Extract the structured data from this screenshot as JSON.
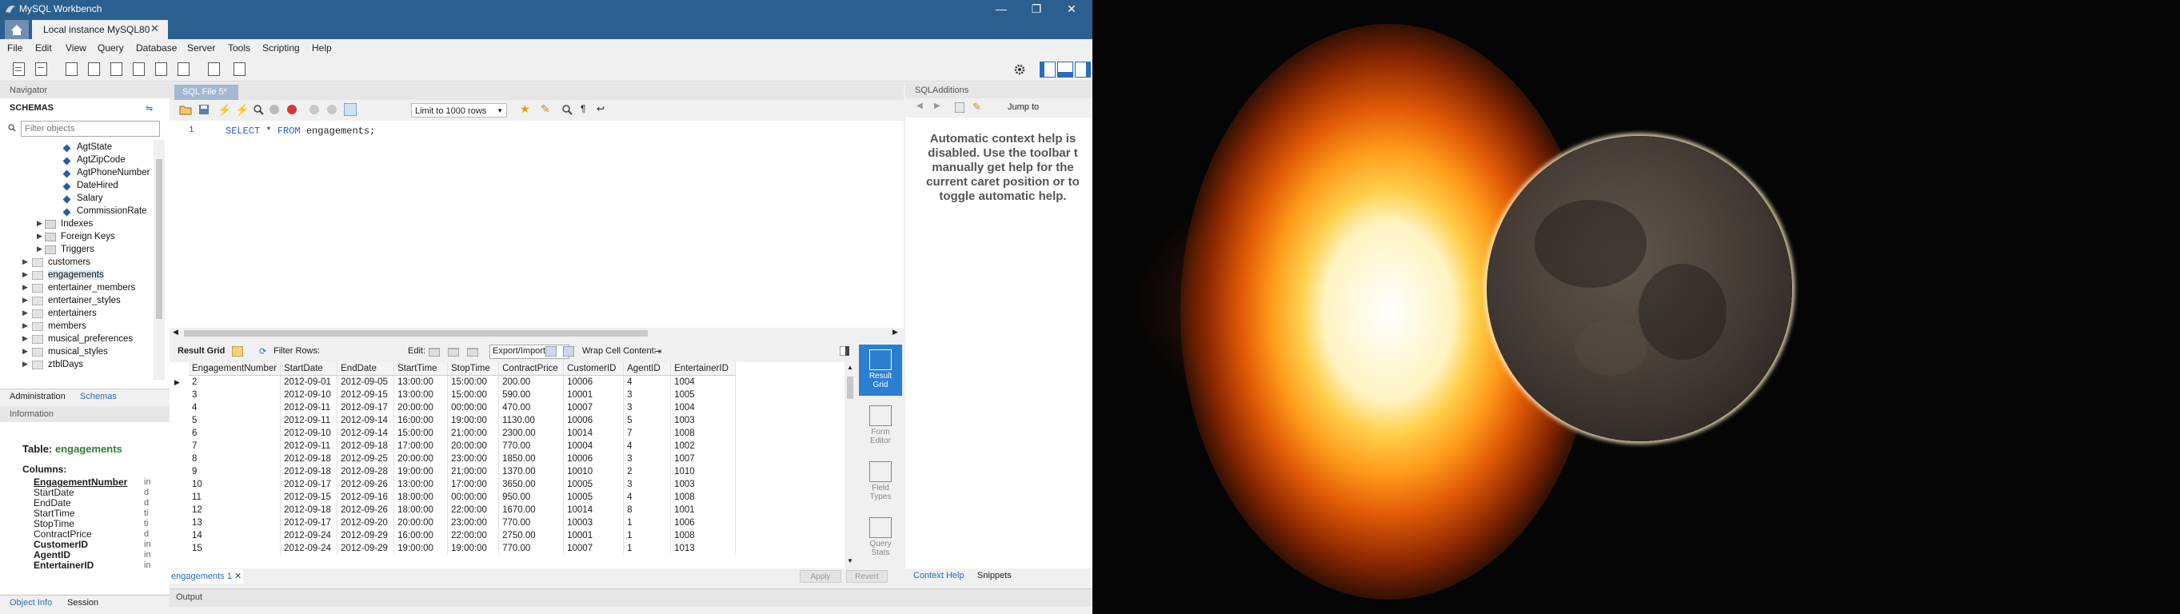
{
  "window": {
    "title": "MySQL Workbench",
    "connection_tab": "Local instance MySQL80",
    "controls": [
      "—",
      "❐",
      "✕"
    ]
  },
  "menu": [
    "File",
    "Edit",
    "View",
    "Query",
    "Database",
    "Server",
    "Tools",
    "Scripting",
    "Help"
  ],
  "navigator": {
    "header": "Navigator",
    "schemas_label": "SCHEMAS",
    "filter_placeholder": "Filter objects",
    "columns": [
      "AgtState",
      "AgtZipCode",
      "AgtPhoneNumber",
      "DateHired",
      "Salary",
      "CommissionRate"
    ],
    "subfolders": [
      "Indexes",
      "Foreign Keys",
      "Triggers"
    ],
    "tables": [
      "customers",
      "engagements",
      "entertainer_members",
      "entertainer_styles",
      "entertainers",
      "members",
      "musical_preferences",
      "musical_styles",
      "ztblDays"
    ],
    "tabs": [
      "Administration",
      "Schemas"
    ]
  },
  "information": {
    "header": "Information",
    "table_label": "Table:",
    "table_name": "engagements",
    "columns_label": "Columns:",
    "columns": [
      {
        "name": "EngagementNumber",
        "type": "in",
        "style": "pk"
      },
      {
        "name": "StartDate",
        "type": "d",
        "style": "normal"
      },
      {
        "name": "EndDate",
        "type": "d",
        "style": "normal"
      },
      {
        "name": "StartTime",
        "type": "ti",
        "style": "normal"
      },
      {
        "name": "StopTime",
        "type": "ti",
        "style": "normal"
      },
      {
        "name": "ContractPrice",
        "type": "d",
        "style": "normal"
      },
      {
        "name": "CustomerID",
        "type": "in",
        "style": "bold"
      },
      {
        "name": "AgentID",
        "type": "in",
        "style": "bold"
      },
      {
        "name": "EntertainerID",
        "type": "in",
        "style": "bold"
      }
    ],
    "tabs": [
      "Object Info",
      "Session"
    ]
  },
  "editor": {
    "tab": "SQL File 5*",
    "limit": "Limit to 1000 rows",
    "line_number": "1",
    "sql_keyword1": "SELECT",
    "sql_rest1": " * ",
    "sql_keyword2": "FROM",
    "sql_rest2": " engagements;"
  },
  "result": {
    "toolbar": {
      "result_grid": "Result Grid",
      "filter_rows": "Filter Rows:",
      "edit": "Edit:",
      "export_import": "Export/Import:",
      "wrap": "Wrap Cell Content:"
    },
    "columns": [
      "EngagementNumber",
      "StartDate",
      "EndDate",
      "StartTime",
      "StopTime",
      "ContractPrice",
      "CustomerID",
      "AgentID",
      "EntertainerID"
    ],
    "rows": [
      [
        "2",
        "2012-09-01",
        "2012-09-05",
        "13:00:00",
        "15:00:00",
        "200.00",
        "10006",
        "4",
        "1004"
      ],
      [
        "3",
        "2012-09-10",
        "2012-09-15",
        "13:00:00",
        "15:00:00",
        "590.00",
        "10001",
        "3",
        "1005"
      ],
      [
        "4",
        "2012-09-11",
        "2012-09-17",
        "20:00:00",
        "00:00:00",
        "470.00",
        "10007",
        "3",
        "1004"
      ],
      [
        "5",
        "2012-09-11",
        "2012-09-14",
        "16:00:00",
        "19:00:00",
        "1130.00",
        "10006",
        "5",
        "1003"
      ],
      [
        "6",
        "2012-09-10",
        "2012-09-14",
        "15:00:00",
        "21:00:00",
        "2300.00",
        "10014",
        "7",
        "1008"
      ],
      [
        "7",
        "2012-09-11",
        "2012-09-18",
        "17:00:00",
        "20:00:00",
        "770.00",
        "10004",
        "4",
        "1002"
      ],
      [
        "8",
        "2012-09-18",
        "2012-09-25",
        "20:00:00",
        "23:00:00",
        "1850.00",
        "10006",
        "3",
        "1007"
      ],
      [
        "9",
        "2012-09-18",
        "2012-09-28",
        "19:00:00",
        "21:00:00",
        "1370.00",
        "10010",
        "2",
        "1010"
      ],
      [
        "10",
        "2012-09-17",
        "2012-09-26",
        "13:00:00",
        "17:00:00",
        "3650.00",
        "10005",
        "3",
        "1003"
      ],
      [
        "11",
        "2012-09-15",
        "2012-09-16",
        "18:00:00",
        "00:00:00",
        "950.00",
        "10005",
        "4",
        "1008"
      ],
      [
        "12",
        "2012-09-18",
        "2012-09-26",
        "18:00:00",
        "22:00:00",
        "1670.00",
        "10014",
        "8",
        "1001"
      ],
      [
        "13",
        "2012-09-17",
        "2012-09-20",
        "20:00:00",
        "23:00:00",
        "770.00",
        "10003",
        "1",
        "1006"
      ],
      [
        "14",
        "2012-09-24",
        "2012-09-29",
        "16:00:00",
        "22:00:00",
        "2750.00",
        "10001",
        "1",
        "1008"
      ],
      [
        "15",
        "2012-09-24",
        "2012-09-29",
        "19:00:00",
        "19:00:00",
        "770.00",
        "10007",
        "1",
        "1013"
      ]
    ],
    "side_buttons": [
      [
        "Result",
        "Grid"
      ],
      [
        "Form",
        "Editor"
      ],
      [
        "Field",
        "Types"
      ],
      [
        "Query",
        "Stats"
      ]
    ],
    "result_tab": "engagements 1",
    "apply": "Apply",
    "revert": "Revert"
  },
  "additions": {
    "header": "SQLAdditions",
    "jump_to": "Jump to",
    "help_text": "Automatic context help is\ndisabled. Use the toolbar t\nmanually get help for the\ncurrent caret position or to\ntoggle automatic help.",
    "tabs": [
      "Context Help",
      "Snippets"
    ]
  },
  "output": {
    "label": "Output"
  },
  "colors": {
    "accent": "#2b5f8f",
    "selected": "#2b7fd0",
    "green": "#2e7d32"
  }
}
